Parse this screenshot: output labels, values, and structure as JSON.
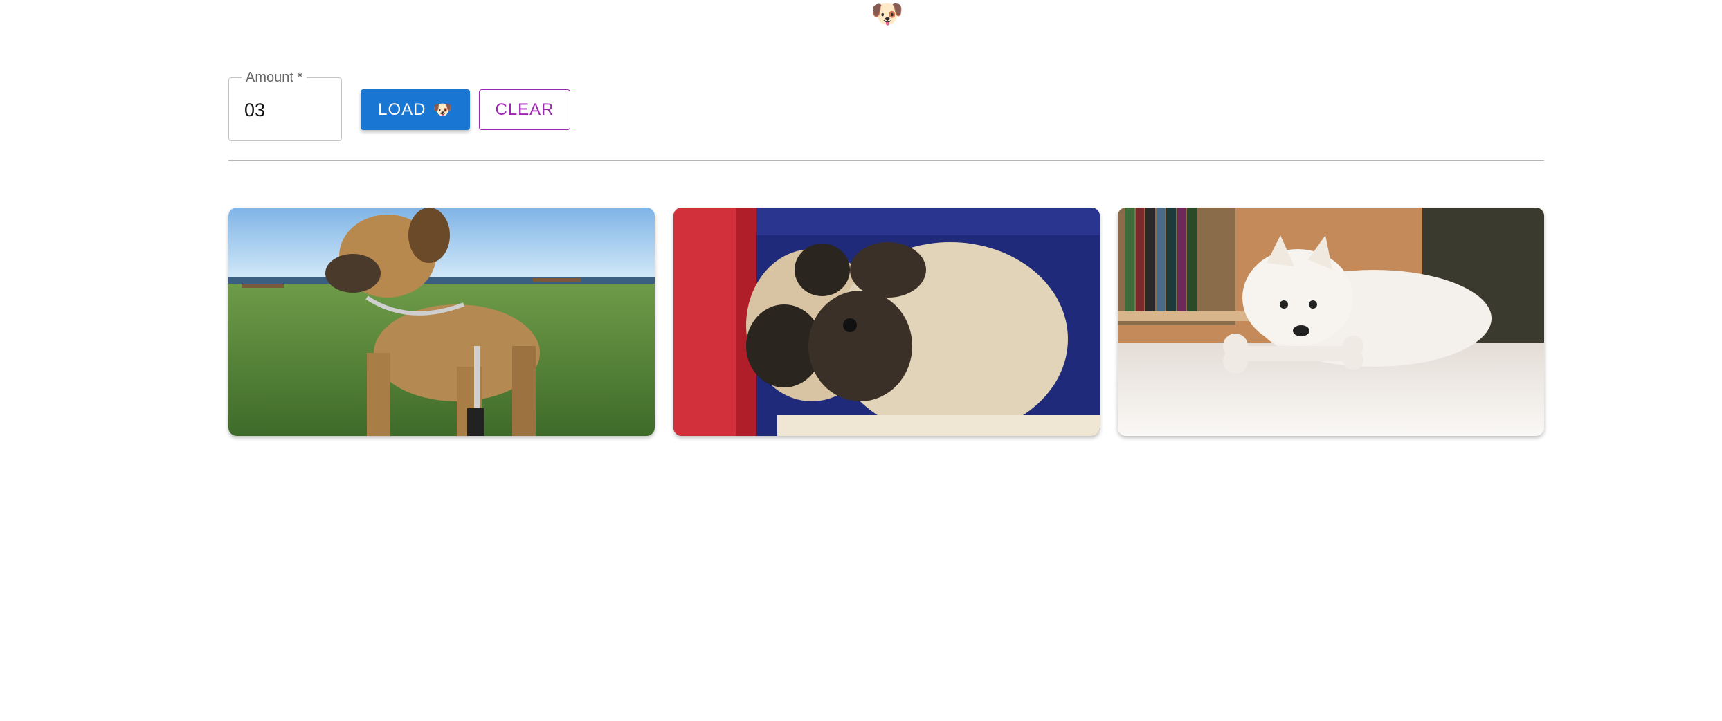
{
  "header": {
    "logo_emoji": "🐶"
  },
  "form": {
    "amount_label": "Amount *",
    "amount_value": "03",
    "load_label": "LOAD",
    "load_emoji": "🐶",
    "clear_label": "CLEAR"
  },
  "gallery": {
    "images": [
      {
        "name": "dog-photo-puggle-on-grass"
      },
      {
        "name": "dog-photo-pugs-in-car-window"
      },
      {
        "name": "dog-photo-white-puppy-with-bone"
      }
    ]
  },
  "colors": {
    "primary": "#1976d2",
    "secondary": "#9c27b0",
    "divider": "#b5b5b5"
  }
}
